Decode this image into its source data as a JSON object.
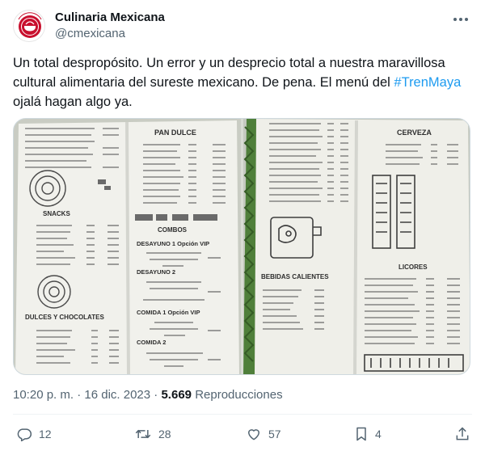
{
  "author": {
    "display_name": "Culinaria Mexicana",
    "handle": "@cmexicana",
    "avatar_icon": "culinaria-mexicana-logo",
    "avatar_color": "#c8102e"
  },
  "tweet": {
    "text_before": "Un total despropósito. Un error y un desprecio total a nuestra maravillosa cultural alimentaria del sureste mexicano. De pena. El menú del ",
    "hashtag": "#TrenMaya",
    "text_after": " ojalá hagan algo ya.",
    "hashtag_color": "#1d9bf0"
  },
  "media": {
    "left_photo": {
      "sections": [
        "PAN DULCE",
        "SNACKS",
        "COMBOS",
        "DESAYUNO 1 Opción VIP",
        "DESAYUNO 2",
        "DULCES Y CHOCOLATES",
        "COMIDA 1 Opción VIP",
        "COMIDA 2"
      ]
    },
    "right_photo": {
      "sections": [
        "CERVEZA",
        "BEBIDAS CALIENTES",
        "LICORES"
      ]
    }
  },
  "meta": {
    "time": "10:20 p. m.",
    "separator": "·",
    "date": "16 dic. 2023",
    "views_count": "5.669",
    "views_label": "Reproducciones"
  },
  "actions": {
    "replies": "12",
    "reposts": "28",
    "likes": "57",
    "bookmarks": "4"
  },
  "colors": {
    "text": "#0f1419",
    "secondary": "#536471",
    "accent": "#1d9bf0",
    "border": "#cfd9de"
  }
}
